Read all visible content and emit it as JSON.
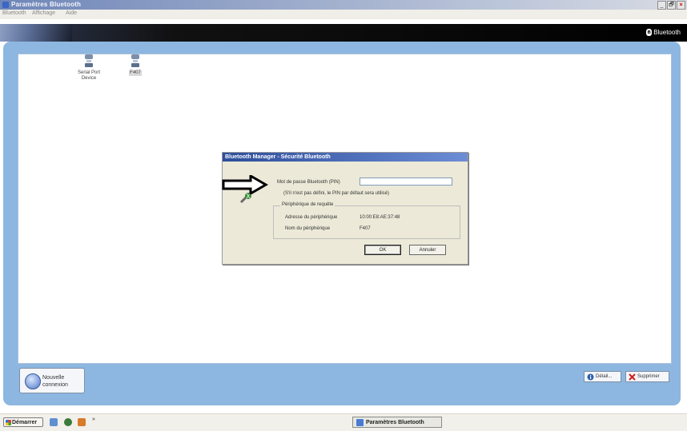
{
  "window": {
    "title": "Paramètres Bluetooth",
    "controls": [
      "_",
      "🗗",
      "×"
    ]
  },
  "menu": {
    "items": [
      "Bluetooth",
      "Affichage",
      "Aide"
    ]
  },
  "header": {
    "brand": "Bluetooth",
    "rune": "ʙ"
  },
  "devices": [
    {
      "label": "Serial Port Device",
      "line1": "Serial Port",
      "line2": "Device"
    },
    {
      "label": "F407"
    }
  ],
  "dialog": {
    "title": "Bluetooth Manager - Sécurité Bluetooth",
    "pin_label": "Mot de passe Bluetooth (PIN)",
    "pin_value": "",
    "pin_hint": "(S'il n'est pas défini, le PIN par défaut sera utilisé)",
    "group_title": "Périphérique de requête",
    "address_label": "Adresse du périphérique",
    "address_value": "10:00:E8:AE:37:48",
    "name_label": "Nom du périphérique",
    "name_value": "F407",
    "ok_label": "OK",
    "cancel_label": "Annuler"
  },
  "bottom": {
    "new_connection_line1": "Nouvelle",
    "new_connection_line2": "connexion",
    "detail_label": "Détail...",
    "delete_label": "Supprimer"
  },
  "taskbar": {
    "start_label": "Démarrer",
    "more": "»",
    "task_label": "Paramètres Bluetooth"
  },
  "colors": {
    "frame_blue": "#8db7e0",
    "titlebar_start": "#6f86b8",
    "dialog_title": "#2d4d9a"
  },
  "icons": [
    "app-icon",
    "bluetooth-rune-icon",
    "serial-port-device-icon",
    "f407-device-icon",
    "bluetooth-key-icon",
    "arrow-icon",
    "new-connection-icon",
    "detail-icon",
    "delete-icon",
    "start-flag-icon"
  ]
}
